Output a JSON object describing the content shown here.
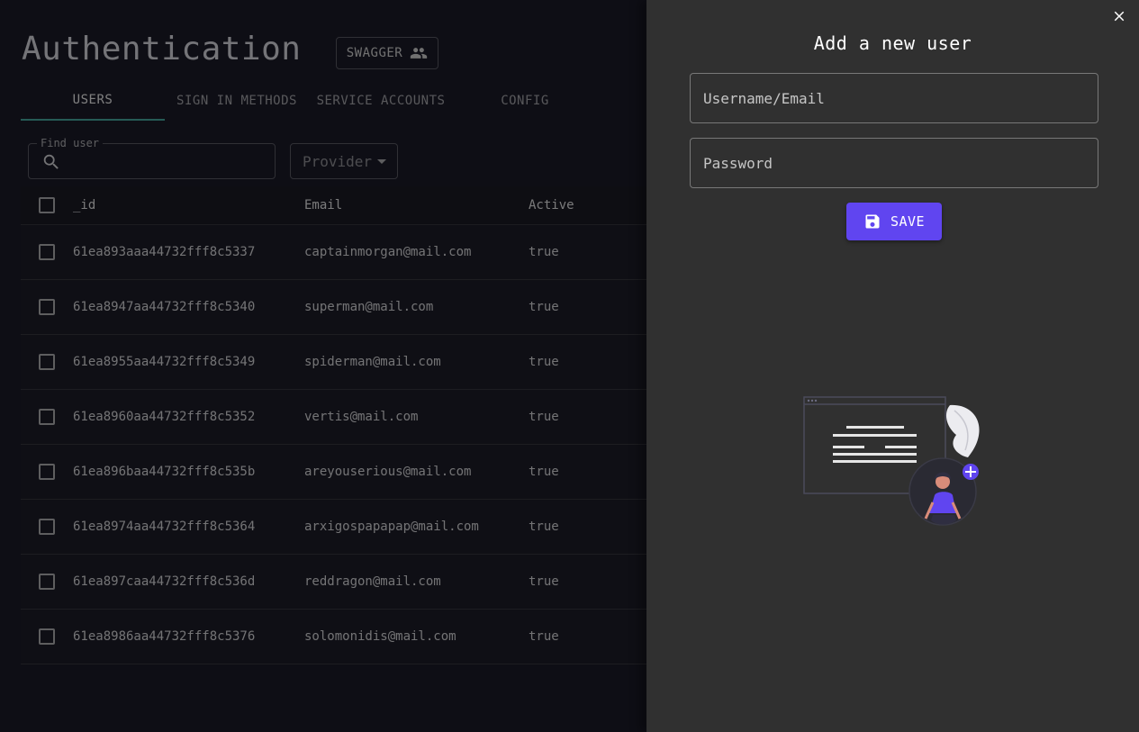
{
  "header": {
    "title": "Authentication",
    "swagger_label": "SWAGGER"
  },
  "tabs": [
    {
      "label": "USERS",
      "active": true
    },
    {
      "label": "SIGN IN METHODS",
      "active": false
    },
    {
      "label": "SERVICE ACCOUNTS",
      "active": false
    },
    {
      "label": "CONFIG",
      "active": false
    }
  ],
  "filters": {
    "search_label": "Find user",
    "search_value": "",
    "provider_label": "Provider"
  },
  "table": {
    "columns": [
      "_id",
      "Email",
      "Active"
    ],
    "rows": [
      {
        "id": "61ea893aaa44732fff8c5337",
        "email": "captainmorgan@mail.com",
        "active": "true"
      },
      {
        "id": "61ea8947aa44732fff8c5340",
        "email": "superman@mail.com",
        "active": "true"
      },
      {
        "id": "61ea8955aa44732fff8c5349",
        "email": "spiderman@mail.com",
        "active": "true"
      },
      {
        "id": "61ea8960aa44732fff8c5352",
        "email": "vertis@mail.com",
        "active": "true"
      },
      {
        "id": "61ea896baa44732fff8c535b",
        "email": "areyouserious@mail.com",
        "active": "true"
      },
      {
        "id": "61ea8974aa44732fff8c5364",
        "email": "arxigospapapap@mail.com",
        "active": "true"
      },
      {
        "id": "61ea897caa44732fff8c536d",
        "email": "reddragon@mail.com",
        "active": "true"
      },
      {
        "id": "61ea8986aa44732fff8c5376",
        "email": "solomonidis@mail.com",
        "active": "true"
      }
    ]
  },
  "drawer": {
    "title": "Add a new user",
    "username_placeholder": "Username/Email",
    "username_value": "",
    "password_placeholder": "Password",
    "password_value": "",
    "save_label": "SAVE"
  },
  "colors": {
    "accent": "#6045f0",
    "tab_indicator": "#4db6ac",
    "page_bg": "#1c1c2b",
    "drawer_bg": "#303030"
  },
  "icons": {
    "swagger": "people-icon",
    "search": "search-icon",
    "provider": "caret-down-icon",
    "close": "close-icon",
    "save": "floppy-disk-icon",
    "illustration": "add-user-illustration"
  }
}
